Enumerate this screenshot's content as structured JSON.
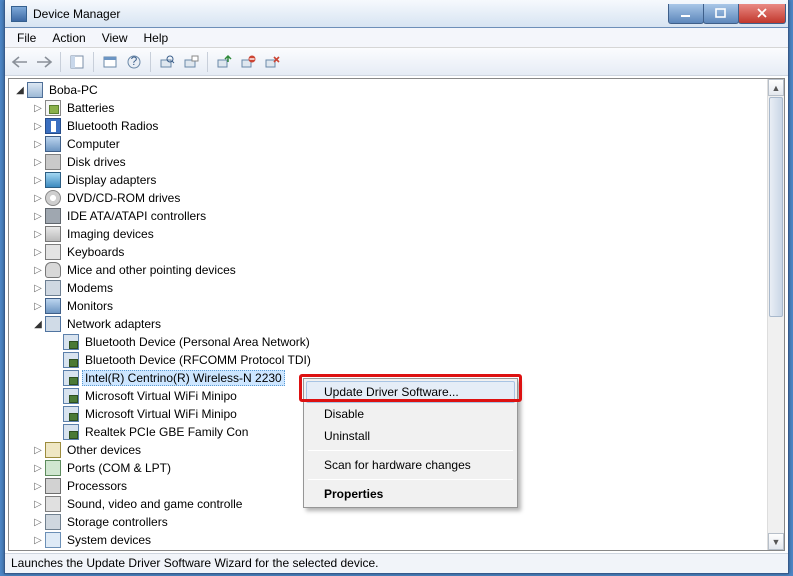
{
  "window": {
    "title": "Device Manager"
  },
  "menubar": [
    "File",
    "Action",
    "View",
    "Help"
  ],
  "toolbar_icons": [
    "back",
    "forward",
    "sep",
    "properties",
    "help",
    "sep",
    "devices",
    "legacy",
    "refresh",
    "sep",
    "update",
    "disable",
    "uninstall"
  ],
  "root_node": {
    "label": "Boba-PC",
    "icon": "ic-pc"
  },
  "categories": [
    {
      "label": "Batteries",
      "icon": "ic-batt",
      "expanded": false
    },
    {
      "label": "Bluetooth Radios",
      "icon": "ic-bt",
      "expanded": false
    },
    {
      "label": "Computer",
      "icon": "ic-mon",
      "expanded": false
    },
    {
      "label": "Disk drives",
      "icon": "ic-disk",
      "expanded": false
    },
    {
      "label": "Display adapters",
      "icon": "ic-disp",
      "expanded": false
    },
    {
      "label": "DVD/CD-ROM drives",
      "icon": "ic-cd",
      "expanded": false
    },
    {
      "label": "IDE ATA/ATAPI controllers",
      "icon": "ic-ide",
      "expanded": false
    },
    {
      "label": "Imaging devices",
      "icon": "ic-img",
      "expanded": false
    },
    {
      "label": "Keyboards",
      "icon": "ic-kb",
      "expanded": false
    },
    {
      "label": "Mice and other pointing devices",
      "icon": "ic-mouse",
      "expanded": false
    },
    {
      "label": "Modems",
      "icon": "ic-modem",
      "expanded": false
    },
    {
      "label": "Monitors",
      "icon": "ic-mon",
      "expanded": false
    },
    {
      "label": "Network adapters",
      "icon": "ic-net",
      "expanded": true,
      "children": [
        {
          "label": "Bluetooth Device (Personal Area Network)",
          "icon": "ic-netcard"
        },
        {
          "label": "Bluetooth Device (RFCOMM Protocol TDI)",
          "icon": "ic-netcard"
        },
        {
          "label": "Intel(R) Centrino(R) Wireless-N 2230",
          "icon": "ic-netcard",
          "selected": true
        },
        {
          "label": "Microsoft Virtual WiFi Minipo",
          "icon": "ic-netcard"
        },
        {
          "label": "Microsoft Virtual WiFi Minipo",
          "icon": "ic-netcard"
        },
        {
          "label": "Realtek PCIe GBE Family Con",
          "icon": "ic-netcard"
        }
      ]
    },
    {
      "label": "Other devices",
      "icon": "ic-other",
      "expanded": false
    },
    {
      "label": "Ports (COM & LPT)",
      "icon": "ic-port",
      "expanded": false
    },
    {
      "label": "Processors",
      "icon": "ic-cpu",
      "expanded": false
    },
    {
      "label": "Sound, video and game controlle",
      "icon": "ic-sound",
      "expanded": false
    },
    {
      "label": "Storage controllers",
      "icon": "ic-stor",
      "expanded": false
    },
    {
      "label": "System devices",
      "icon": "ic-sys",
      "expanded": false
    }
  ],
  "context_menu": {
    "items": [
      {
        "label": "Update Driver Software...",
        "hover": true
      },
      {
        "label": "Disable"
      },
      {
        "label": "Uninstall"
      },
      {
        "sep": true
      },
      {
        "label": "Scan for hardware changes"
      },
      {
        "sep": true
      },
      {
        "label": "Properties",
        "bold": true
      }
    ]
  },
  "statusbar": "Launches the Update Driver Software Wizard for the selected device."
}
